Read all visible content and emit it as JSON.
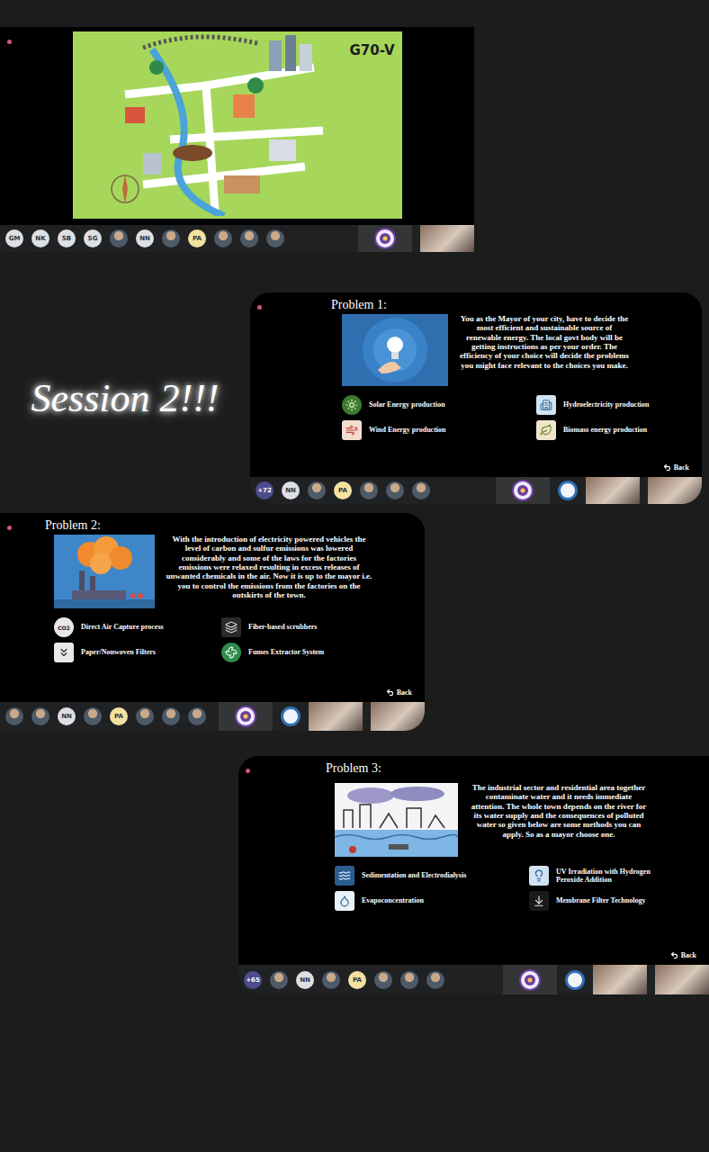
{
  "title_screen": {
    "slide": {
      "title": "G70-V"
    },
    "participants": [
      {
        "kind": "initials",
        "text": "GM",
        "color": "#dcdfe4"
      },
      {
        "kind": "initials",
        "text": "NK",
        "color": "#dcdfe4"
      },
      {
        "kind": "initials",
        "text": "SB",
        "color": "#dcdfe4"
      },
      {
        "kind": "initials",
        "text": "SG",
        "color": "#dcdfe4"
      },
      {
        "kind": "photo"
      },
      {
        "kind": "initials",
        "text": "NN",
        "color": "#dcdfe4"
      },
      {
        "kind": "photo"
      },
      {
        "kind": "initials",
        "text": "PA",
        "color": "#f3e2a0"
      },
      {
        "kind": "photo"
      },
      {
        "kind": "photo"
      },
      {
        "kind": "photo"
      },
      {
        "kind": "emblem"
      },
      {
        "kind": "video"
      }
    ]
  },
  "caption": "Session 2!!!",
  "problems": [
    {
      "title": "Problem 1:",
      "body": "You as the Mayor of your city, have to decide the most efficient and sustainable source of renewable energy. The local govt body will be getting instructions as per your order. The efficiency of your choice will decide the problems you might face relevant to the choices you make.",
      "options": [
        {
          "label": "Solar Energy production"
        },
        {
          "label": "Hydroelectricity production"
        },
        {
          "label": "Wind Energy production"
        },
        {
          "label": "Biomass energy production"
        }
      ],
      "back": "Back",
      "participants": [
        {
          "kind": "initials",
          "text": "+72",
          "color": "#4b4c8e"
        },
        {
          "kind": "initials",
          "text": "NN",
          "color": "#dcdfe4"
        },
        {
          "kind": "photo"
        },
        {
          "kind": "initials",
          "text": "PA",
          "color": "#f3e2a0"
        },
        {
          "kind": "photo"
        },
        {
          "kind": "photo"
        },
        {
          "kind": "photo"
        },
        {
          "kind": "emblem"
        },
        {
          "kind": "logo"
        },
        {
          "kind": "video"
        },
        {
          "kind": "video"
        }
      ]
    },
    {
      "title": "Problem 2:",
      "body": "With the introduction of electricity powered vehicles the level of carbon and sulfur emissions was lowered considerably and some of the laws for the factories emissions were relaxed resulting in excess releases of unwanted chemicals in the air. Now it is up to the mayor i.e. you to control the emissions from the factories on the outskirts of the town.",
      "options": [
        {
          "label": "Direct Air Capture process",
          "icon_text": "CO2"
        },
        {
          "label": "Fiber-based scrubbers"
        },
        {
          "label": "Paper/Nonwoven Filters"
        },
        {
          "label": "Fumes Extractor System"
        }
      ],
      "back": "Back",
      "participants": [
        {
          "kind": "photo"
        },
        {
          "kind": "photo"
        },
        {
          "kind": "initials",
          "text": "NN",
          "color": "#dcdfe4"
        },
        {
          "kind": "photo"
        },
        {
          "kind": "initials",
          "text": "PA",
          "color": "#f3e2a0"
        },
        {
          "kind": "photo"
        },
        {
          "kind": "photo"
        },
        {
          "kind": "photo"
        },
        {
          "kind": "emblem"
        },
        {
          "kind": "logo"
        },
        {
          "kind": "video"
        },
        {
          "kind": "video"
        }
      ]
    },
    {
      "title": "Problem 3:",
      "body": "The industrial sector and residential area together contaminate water and it needs immediate attention. The whole town depends on the river for its water supply and the consequences of polluted water so given below are some methods you can apply. So as a mayor choose one.",
      "options": [
        {
          "label": "Sedimentation and Electrodialysis"
        },
        {
          "label": "UV Irradiation with Hydrogen Peroxide Addition"
        },
        {
          "label": "Evapoconcentration"
        },
        {
          "label": "Membrane Filter Technology"
        }
      ],
      "back": "Back",
      "participants": [
        {
          "kind": "initials",
          "text": "+65",
          "color": "#4b4c8e"
        },
        {
          "kind": "photo"
        },
        {
          "kind": "initials",
          "text": "NN",
          "color": "#dcdfe4"
        },
        {
          "kind": "photo"
        },
        {
          "kind": "initials",
          "text": "PA",
          "color": "#f3e2a0"
        },
        {
          "kind": "photo"
        },
        {
          "kind": "photo"
        },
        {
          "kind": "photo"
        },
        {
          "kind": "emblem"
        },
        {
          "kind": "logo"
        },
        {
          "kind": "video"
        },
        {
          "kind": "video"
        }
      ]
    }
  ]
}
